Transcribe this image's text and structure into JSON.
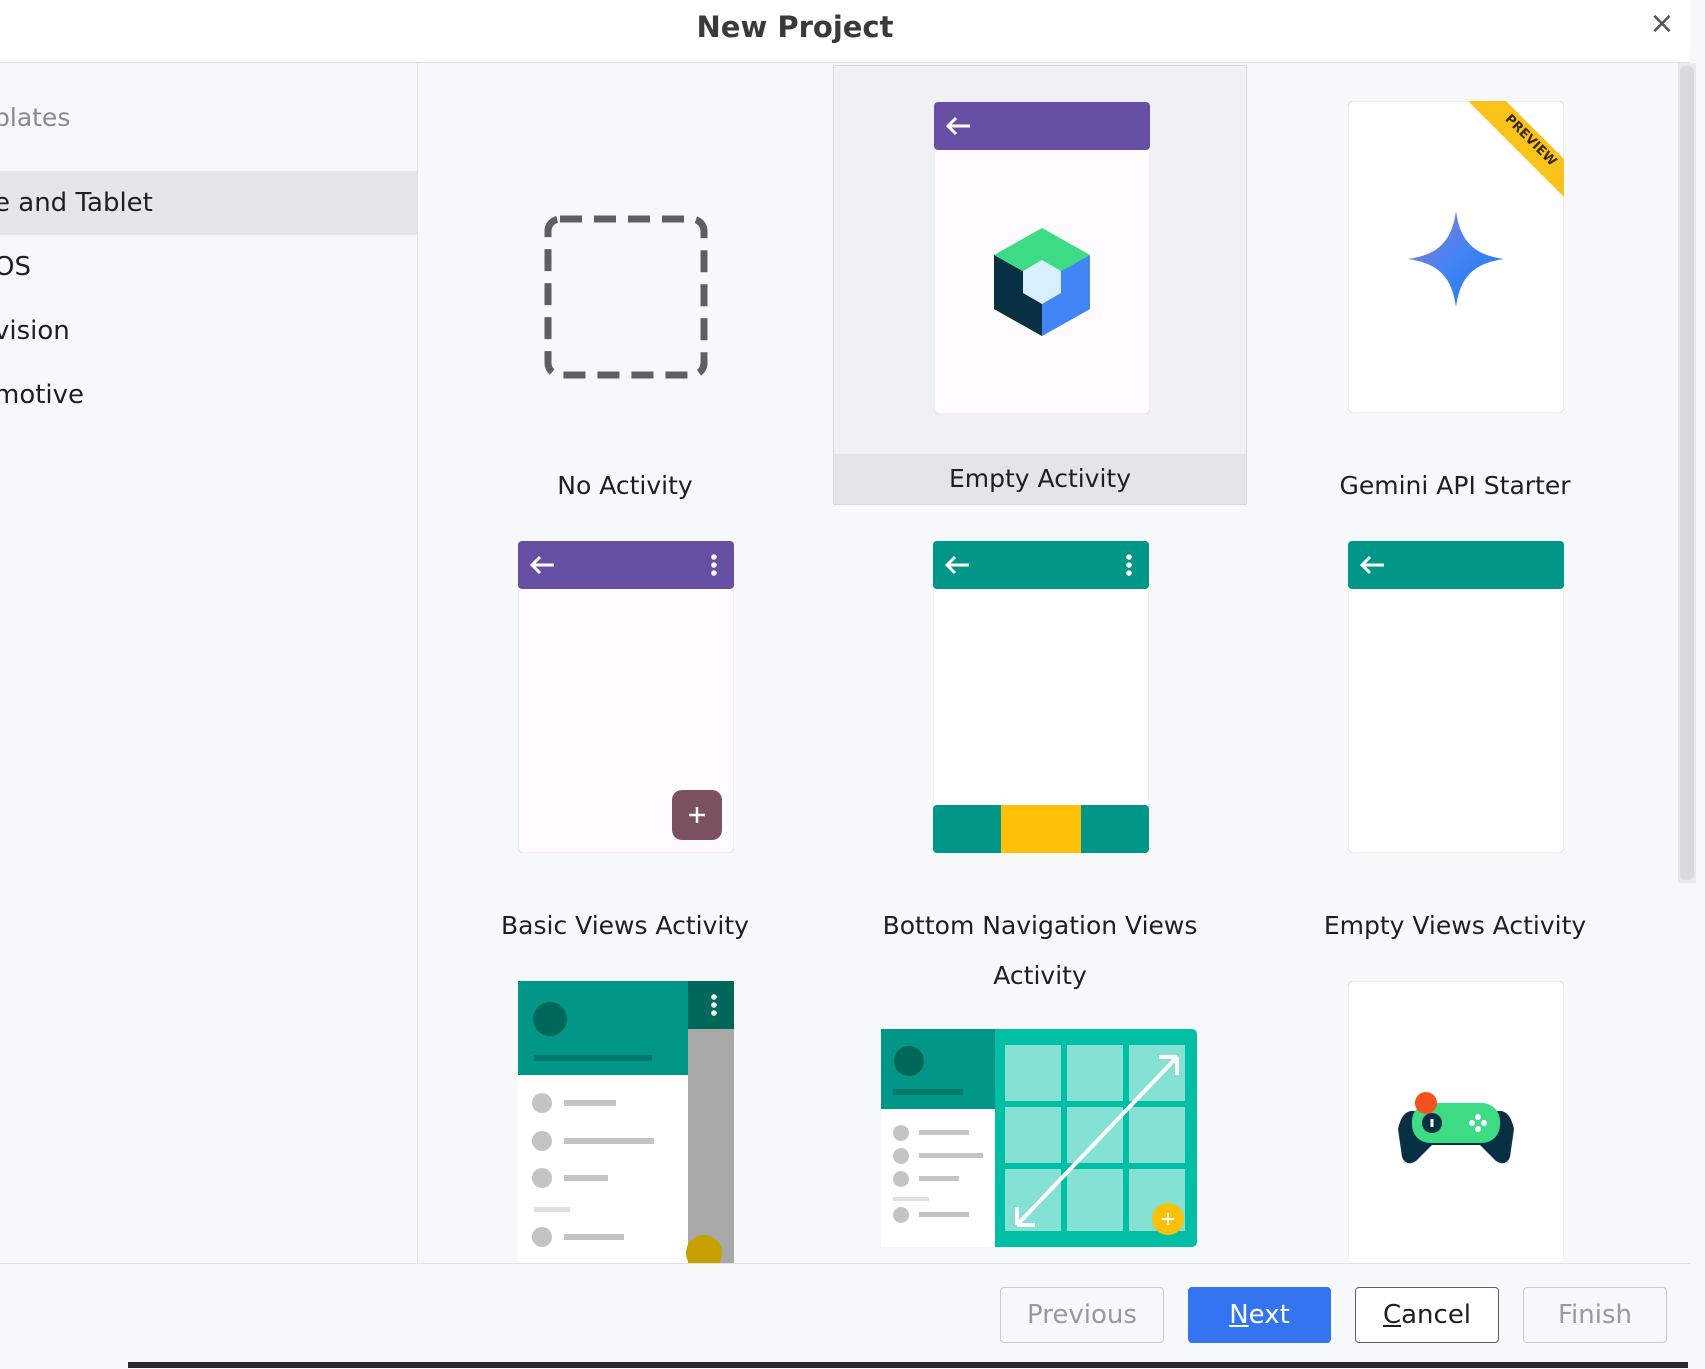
{
  "window": {
    "title": "New Project",
    "close_glyph": "×"
  },
  "sidebar": {
    "header": "plates",
    "items": [
      {
        "label": "e and Tablet",
        "selected": true
      },
      {
        "label": "OS"
      },
      {
        "label": "vision"
      },
      {
        "label": "motive"
      }
    ]
  },
  "templates": [
    {
      "label": "No Activity"
    },
    {
      "label": "Empty Activity",
      "selected": true
    },
    {
      "label": "Gemini API Starter",
      "badge": "PREVIEW"
    },
    {
      "label": "Basic Views Activity"
    },
    {
      "label": "Bottom Navigation Views Activity"
    },
    {
      "label": "Empty Views Activity"
    },
    {
      "label": ""
    },
    {
      "label": ""
    },
    {
      "label": ""
    }
  ],
  "footer": {
    "previous_label": "Previous",
    "next_first": "N",
    "next_rest": "ext",
    "cancel_first": "C",
    "cancel_rest": "ancel",
    "finish_label": "Finish"
  },
  "colors": {
    "accent": "#3574f0",
    "purple_bar": "#6750a4",
    "teal_bar": "#009688",
    "yellow": "#ffc107"
  }
}
